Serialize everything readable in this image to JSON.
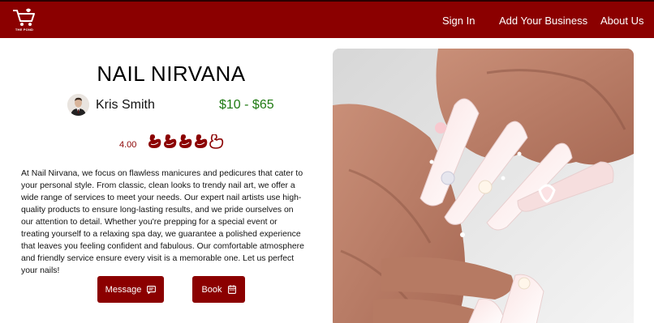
{
  "header": {
    "logo_text": "THE POND",
    "nav": {
      "sign_in": "Sign In",
      "add_business": "Add Your Business",
      "about": "About Us"
    },
    "bar_color": "#8b0000"
  },
  "business": {
    "name": "NAIL NIRVANA",
    "owner": "Kris Smith",
    "price_range": "$10 - $65",
    "rating": "4.00",
    "rating_value": 4,
    "rating_max": 5,
    "rating_icon": "duck-icon",
    "description": "At Nail Nirvana, we focus on flawless manicures and pedicures that cater to your personal style. From classic, clean looks to trendy nail art, we offer a wide range of services to meet your needs. Our expert nail artists use high-quality products to ensure long-lasting results, and we pride ourselves on our attention to detail. Whether you're prepping for a special event or treating yourself to a relaxing spa day, we guarantee a polished experience that leaves you feeling confident and fabulous. Our comfortable atmosphere and friendly service ensure every visit is a memorable one. Let us perfect your nails!"
  },
  "actions": {
    "message_label": "Message",
    "message_icon": "chat-icon",
    "book_label": "Book",
    "book_icon": "calendar-icon"
  },
  "colors": {
    "accent": "#8b0000",
    "price": "#1f7a12"
  }
}
